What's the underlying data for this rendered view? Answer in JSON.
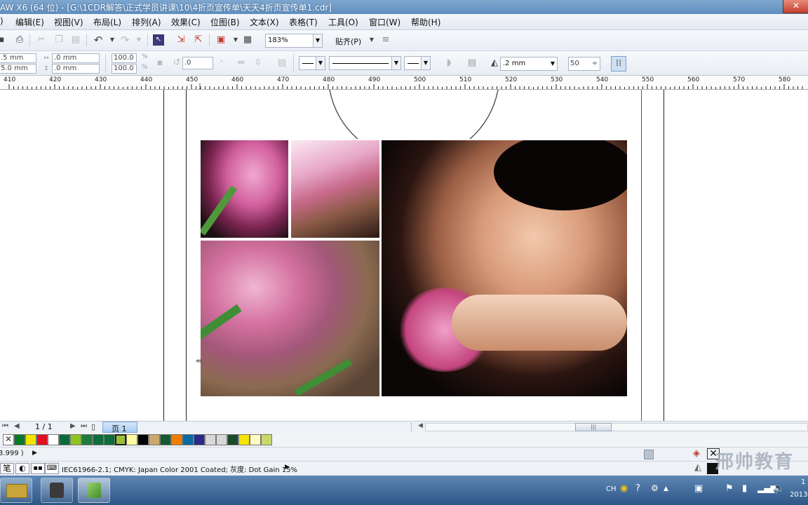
{
  "window": {
    "title": "AW X6 (64 位) - [G:\\1CDR解答\\正式学员讲课\\10\\4折页宣传单\\天天4折页宣传单1.cdr]",
    "close_glyph": "✕"
  },
  "menu": [
    "编辑(E)",
    "视图(V)",
    "布局(L)",
    "排列(A)",
    "效果(C)",
    "位图(B)",
    "文本(X)",
    "表格(T)",
    "工具(O)",
    "窗口(W)",
    "帮助(H)"
  ],
  "menu_partial": ")",
  "toolbar": {
    "zoom": "183%",
    "snap_label": "贴齐(P)"
  },
  "property_bar": {
    "size_w": ".5 mm",
    "size_h": "5.0 mm",
    "pos_x": ".0 mm",
    "pos_y": ".0 mm",
    "scale_x": "100.0",
    "scale_y": "100.0",
    "scale_unit": "%",
    "rotation": ".0",
    "outline_width": ".2 mm",
    "value_50": "50"
  },
  "ruler": {
    "labels": [
      "410",
      "420",
      "430",
      "440",
      "450",
      "460",
      "470",
      "480",
      "490",
      "500",
      "510",
      "520",
      "530",
      "540",
      "550",
      "560",
      "570",
      "580"
    ]
  },
  "page_nav": {
    "counter": "1 / 1",
    "page_tab": "页 1"
  },
  "palette": {
    "colors": [
      "#0a7a2a",
      "#f5e400",
      "#e01020",
      "#ffffff",
      "#0b6a3a",
      "#8fc31f",
      "#1e7b3c",
      "#0e6d3a",
      "#9ac03a",
      "#fffaa0",
      "#000000",
      "#c9a96e",
      "#145a32",
      "#f07d00",
      "#0c6aa0",
      "#2a2a8a",
      "#d8d8d8",
      "#1a4a2a",
      "#f5e400",
      "#fffbc2",
      "#c8d86a"
    ]
  },
  "status": {
    "coords_partial": "3.999 )",
    "color_profile": "IEC61966-2.1; CMYK: Japan Color 2001 Coated; 灰度: Dot Gain 15%",
    "pen_label": "笔"
  },
  "taskbar": {
    "lang": "CH",
    "clock_partial": "1",
    "year_partial": "2013"
  },
  "watermark": {
    "text": "邢帅教育"
  }
}
